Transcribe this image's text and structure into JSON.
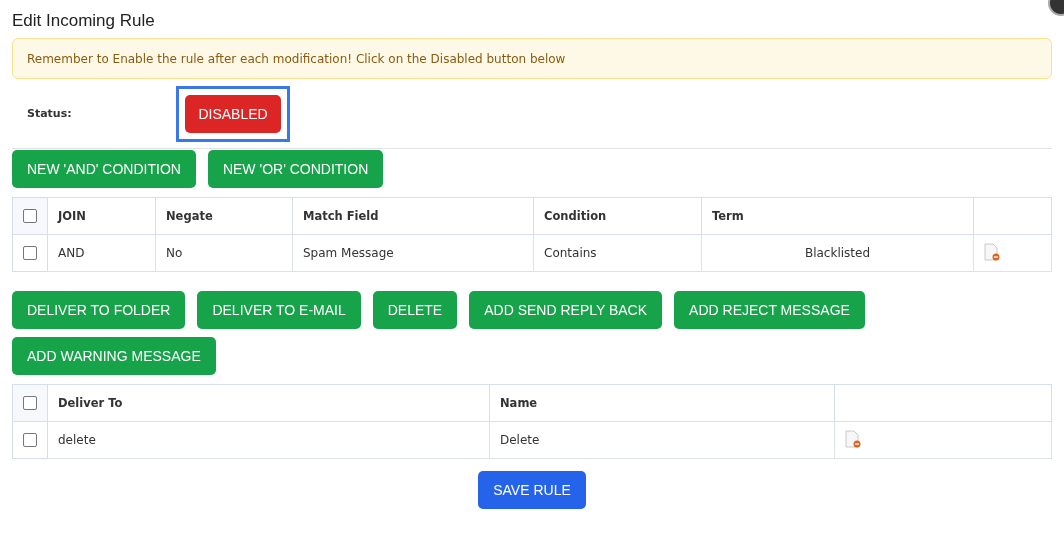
{
  "dialog": {
    "title": "Edit Incoming Rule"
  },
  "alert": "Remember to Enable the rule after each modification! Click on the Disabled button below",
  "status": {
    "label": "Status:",
    "button": "DISABLED",
    "enabled": false,
    "focused": true
  },
  "condition_buttons": [
    "NEW 'AND' CONDITION",
    "NEW 'OR' CONDITION"
  ],
  "conditions_table": {
    "select_all_checked": false,
    "columns": [
      "JOIN",
      "Negate",
      "Match Field",
      "Condition",
      "Term"
    ],
    "rows": [
      {
        "checked": false,
        "cells": [
          "AND",
          "No",
          "Spam Message",
          "Contains",
          "Blacklisted"
        ]
      }
    ]
  },
  "action_buttons": [
    "DELIVER TO FOLDER",
    "DELIVER TO E-MAIL",
    "DELETE",
    "ADD SEND REPLY BACK",
    "ADD REJECT MESSAGE",
    "ADD WARNING MESSAGE"
  ],
  "actions_table": {
    "select_all_checked": false,
    "columns": [
      "Deliver To",
      "Name"
    ],
    "rows": [
      {
        "checked": false,
        "cells": [
          "delete",
          "Delete"
        ]
      }
    ]
  },
  "save_button": "SAVE RULE"
}
